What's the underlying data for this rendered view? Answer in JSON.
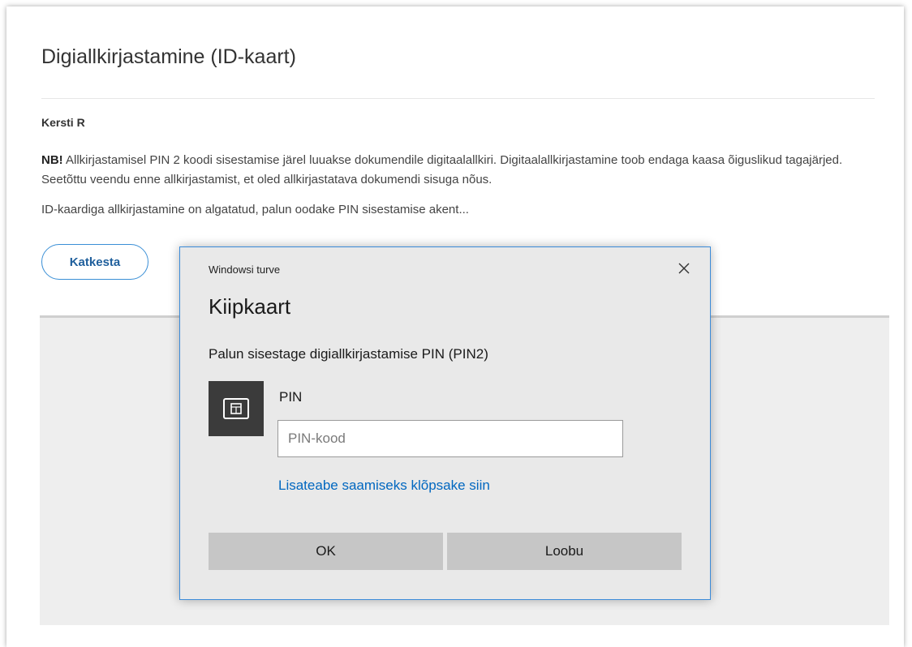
{
  "page": {
    "title": "Digiallkirjastamine (ID-kaart)",
    "user_name": "Kersti R",
    "notice_bold": "NB!",
    "notice_text": " Allkirjastamisel PIN 2 koodi sisestamise järel luuakse dokumendile digitaalallkiri. Digitaalallkirjastamine toob endaga kaasa õiguslikud tagajärjed. Seetõttu veendu enne allkirjastamist, et oled allkirjastatava dokumendi sisuga nõus.",
    "status_text": "ID-kaardiga allkirjastamine on algatatud, palun oodake PIN sisestamise akent...",
    "cancel_label": "Katkesta",
    "accent_color": "#3a8fd6"
  },
  "dialog": {
    "caption": "Windowsi turve",
    "title": "Kiipkaart",
    "message": "Palun sisestage digiallkirjastamise PIN (PIN2)",
    "pin_label": "PIN",
    "pin_value": "",
    "pin_placeholder": "PIN-kood",
    "more_info_link": "Lisateabe saamiseks klõpsake siin",
    "ok_label": "OK",
    "cancel_label": "Loobu",
    "icons": {
      "close": "close-icon",
      "card": "smartcard-icon"
    },
    "link_color": "#0067c0",
    "border_color": "#3b8bd9"
  }
}
